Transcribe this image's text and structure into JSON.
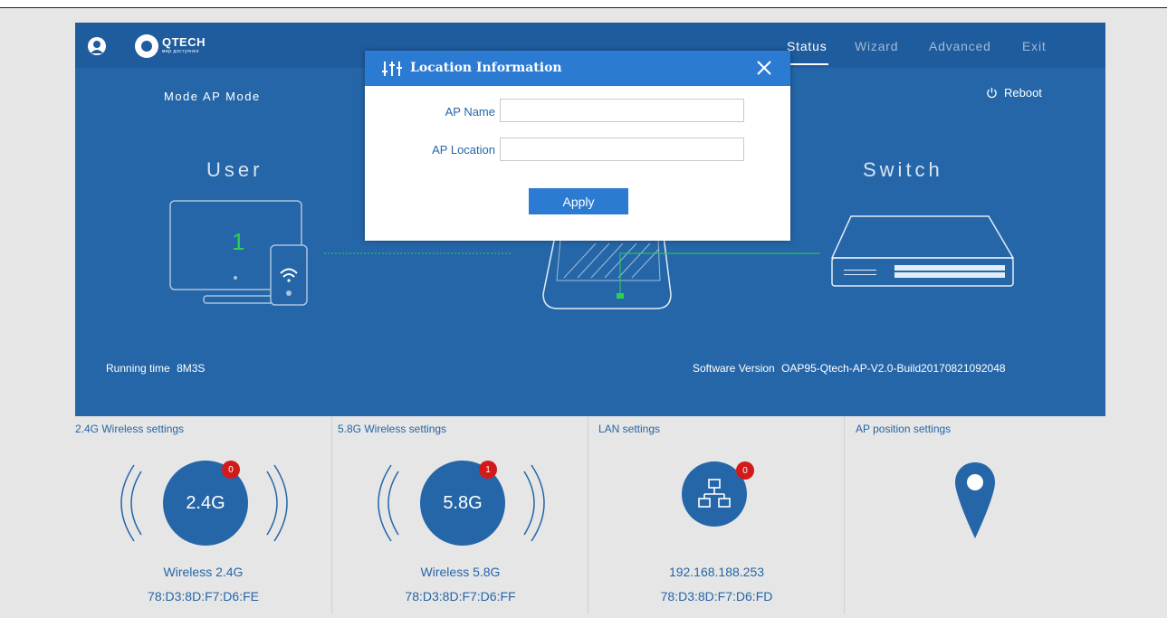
{
  "header": {
    "logo_text": "QTECH",
    "logo_sub": "мир доступнее",
    "nav": [
      {
        "label": "Status",
        "active": true
      },
      {
        "label": "Wizard",
        "active": false
      },
      {
        "label": "Advanced",
        "active": false
      },
      {
        "label": "Exit",
        "active": false
      }
    ]
  },
  "status": {
    "mode_label": "Mode",
    "mode_value": "AP Mode",
    "reboot_label": "Reboot",
    "user_title": "User",
    "switch_title": "Switch",
    "user_count": "1",
    "running_label": "Running time",
    "running_value": "8M3S",
    "software_label": "Software Version",
    "software_value": "OAP95-Qtech-AP-V2.0-Build20170821092048"
  },
  "cards": [
    {
      "title": "2.4G Wireless settings",
      "icon": "2.4G",
      "badge": "0",
      "line1": "Wireless 2.4G",
      "line2": "78:D3:8D:F7:D6:FE"
    },
    {
      "title": "5.8G Wireless settings",
      "icon": "5.8G",
      "badge": "1",
      "line1": "Wireless 5.8G",
      "line2": "78:D3:8D:F7:D6:FF"
    },
    {
      "title": "LAN settings",
      "icon": "network-icon",
      "badge": "0",
      "line1": "192.168.188.253",
      "line2": "78:D3:8D:F7:D6:FD"
    },
    {
      "title": "AP position settings",
      "icon": "map-pin-icon"
    }
  ],
  "modal": {
    "title": "Location Information",
    "ap_name_label": "AP Name",
    "ap_name_value": "",
    "ap_location_label": "AP Location",
    "ap_location_value": "",
    "apply_label": "Apply"
  },
  "colors": {
    "panel": "#2566a8",
    "topbar": "#1f5c9e",
    "modal_header": "#2c7bd3",
    "badge": "#d31a1a",
    "link_green": "#2bd24e"
  }
}
